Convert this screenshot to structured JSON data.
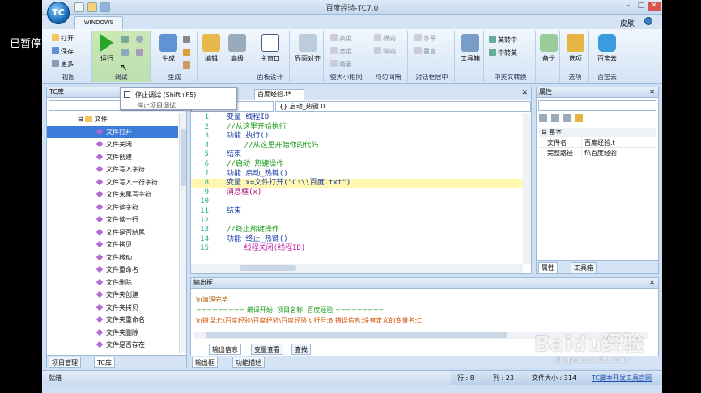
{
  "overlay": {
    "paused_text": "已暂停"
  },
  "window": {
    "title": "百度经验-TC7.0",
    "orb_label": "TC",
    "skin_label": "皮肤"
  },
  "ribbon_tabs": [
    {
      "label": "WINDOWS"
    }
  ],
  "ribbon": {
    "groups": {
      "view": {
        "label": "视图",
        "items": [
          "打开",
          "保存",
          "更多"
        ]
      },
      "debug": {
        "label": "调试",
        "run_label": "运行"
      },
      "generate": {
        "label": "生成",
        "build_label": "生成"
      },
      "edit": {
        "label": "编辑"
      },
      "advanced": {
        "label": "高级"
      },
      "panel_design": {
        "label": "面板设计",
        "main_window": "主窗口"
      },
      "interface": {
        "label": "界面对齐"
      },
      "resize": {
        "label": "使大小相同",
        "items": [
          "高度",
          "宽度",
          "两者"
        ]
      },
      "spacing": {
        "label": "均匀间隔",
        "items": [
          "横向",
          "纵向"
        ]
      },
      "center": {
        "label": "对话框居中",
        "items": [
          "水平",
          "垂直"
        ]
      },
      "toolbar_grp": {
        "label": "",
        "tool_label": "工具箱"
      },
      "convert": {
        "label": "中英文转换",
        "items": [
          "英转中",
          "中转英"
        ]
      },
      "backup": {
        "label": "备份"
      },
      "options": {
        "label": "选项"
      },
      "store": {
        "label": "百宝云"
      }
    }
  },
  "debug_menu": {
    "stop_label": "停止调试 (Shift+F5)",
    "stop_tooltip": "停止项目调试"
  },
  "tc_panel": {
    "title": "TC库",
    "root": "文件",
    "items": [
      "文件打开",
      "文件关闭",
      "文件创建",
      "文件写入字符",
      "文件写入一行字符",
      "文件末尾写字符",
      "文件读字符",
      "文件读一行",
      "文件是否结尾",
      "文件拷贝",
      "文件移动",
      "文件重命名",
      "文件删除",
      "文件夹创建",
      "文件夹拷贝",
      "文件夹重命名",
      "文件夹删除",
      "文件是否存在"
    ],
    "tabs": [
      "项目管理",
      "TC库"
    ]
  },
  "editor": {
    "doc_tab": "百度经验.t*",
    "func_combo": "{} 启动_热键 0",
    "lines": [
      {
        "n": "1",
        "text": "变量 线程ID",
        "cls": "k"
      },
      {
        "n": "2",
        "text": "//从这里开始执行",
        "cls": "c"
      },
      {
        "n": "3",
        "text": "功能 执行()",
        "cls": "k"
      },
      {
        "n": "4",
        "text": "    //从这里开始你的代码",
        "cls": "c"
      },
      {
        "n": "5",
        "text": "结束",
        "cls": "k"
      },
      {
        "n": "6",
        "text": "//启动_热键操作",
        "cls": "c"
      },
      {
        "n": "7",
        "text": "功能 启动_热键()",
        "cls": "k"
      },
      {
        "n": "8",
        "text": "变量 x=文件打开(\"C:\\\\百度.txt\")",
        "cls": "k",
        "hl": true
      },
      {
        "n": "9",
        "text": "消息框(x)",
        "cls": "f"
      },
      {
        "n": "10",
        "text": "",
        "cls": ""
      },
      {
        "n": "11",
        "text": "结束",
        "cls": "k"
      },
      {
        "n": "12",
        "text": "",
        "cls": ""
      },
      {
        "n": "13",
        "text": "//终止热键操作",
        "cls": "c"
      },
      {
        "n": "14",
        "text": "功能 终止_热键()",
        "cls": "k"
      },
      {
        "n": "15",
        "text": "    线程关闭(线程ID)",
        "cls": "s"
      }
    ]
  },
  "properties": {
    "title": "属性",
    "section": "基本",
    "rows": [
      {
        "key": "文件名",
        "value": "百度经验.t"
      },
      {
        "key": "完整路径",
        "value": "f:\\百度经验"
      }
    ],
    "tabs": [
      "属性",
      "工具箱"
    ]
  },
  "output": {
    "title": "输出框",
    "lines": [
      "\\n清理完毕",
      "========= 编译开始: 项目名称: 百度经验 =========",
      "\\n错误:F:\\百度经验\\百度经验\\百度经验.t 行号:8 错误信息:没有定义的变量名:C"
    ],
    "tabs": [
      "输出信息",
      "变量查看",
      "查找"
    ],
    "bottom_tabs": [
      "输出框",
      "功能描述"
    ]
  },
  "status": {
    "ready": "就绪",
    "row": "行 : 8",
    "col": "列 : 23",
    "size": "文件大小 : 314",
    "link": "TC脚本开发工具官网"
  },
  "watermark": {
    "brand": "Baidu经验",
    "url": "jingyan.baidu.com"
  }
}
